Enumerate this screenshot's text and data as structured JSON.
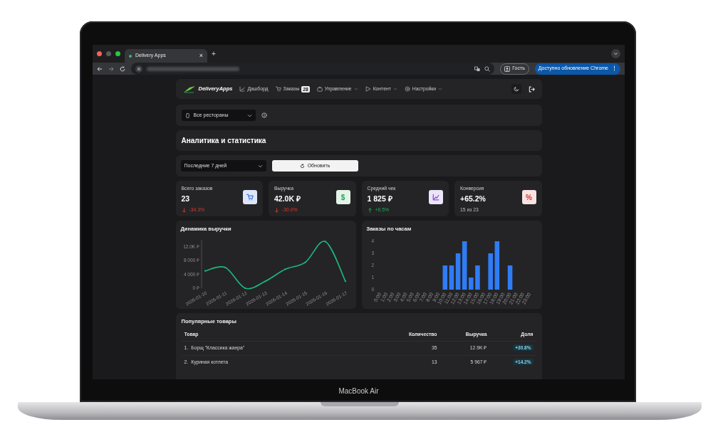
{
  "browser": {
    "tab": {
      "title": "Delivery Apps",
      "close": "×",
      "selected": true
    },
    "new_tab": "+",
    "profile": "Гость",
    "update_button": "Доступно обновление Chrome",
    "menu": "⋮"
  },
  "navbar": {
    "brand": "DeliveryApps",
    "items": [
      {
        "label": "Дашборд",
        "dropdown": false
      },
      {
        "label": "Заказы",
        "badge": "28",
        "dropdown": false
      },
      {
        "label": "Управление",
        "dropdown": true
      },
      {
        "label": "Контент",
        "dropdown": true
      },
      {
        "label": "Настройки",
        "dropdown": true
      }
    ]
  },
  "restaurant_select": {
    "value": "Все рестораны"
  },
  "page_title": "Аналитика и статистика",
  "period_select": {
    "value": "Последние 7 дней"
  },
  "refresh_button": "Обновить",
  "stats": [
    {
      "label": "Всего заказов",
      "value": "23",
      "change": "-34.3%",
      "kind": "down"
    },
    {
      "label": "Выручка",
      "value": "42.0K ₽",
      "change": "-30.0%",
      "kind": "down",
      "symbol": "$"
    },
    {
      "label": "Средний чек",
      "value": "1 825 ₽",
      "change": "+6.5%",
      "kind": "up"
    },
    {
      "label": "Конверсия",
      "value": "+65.2%",
      "change": "15 из 23",
      "kind": "plain",
      "symbol": "%"
    }
  ],
  "revenue_chart": {
    "title": "Динамика выручки",
    "chart_data": {
      "type": "line",
      "categories": [
        "2026-01-10",
        "2026-01-11",
        "2026-01-12",
        "2026-01-13",
        "2026-01-14",
        "2026-01-15",
        "2026-01-16",
        "2026-01-17"
      ],
      "series": [
        {
          "color": "#1db87c",
          "values": [
            5000,
            6000,
            0,
            2000,
            5500,
            7500,
            13500,
            2000
          ]
        }
      ],
      "ylim": [
        0,
        14000
      ],
      "yticks": [
        {
          "value": 0,
          "label": "0 ₽"
        },
        {
          "value": 4000,
          "label": "4 000 ₽"
        },
        {
          "value": 8000,
          "label": "8 000 ₽"
        },
        {
          "value": 12000,
          "label": "12.0K ₽"
        }
      ]
    }
  },
  "hourly_chart": {
    "title": "Заказы по часам",
    "chart_data": {
      "type": "bar",
      "categories": [
        "0:00",
        "1:00",
        "2:00",
        "3:00",
        "4:00",
        "5:00",
        "6:00",
        "7:00",
        "8:00",
        "9:00",
        "10:00",
        "11:00",
        "12:00",
        "13:00",
        "14:00",
        "15:00",
        "16:00",
        "17:00",
        "18:00",
        "19:00",
        "20:00",
        "21:00",
        "22:00",
        "23:00"
      ],
      "series": [
        {
          "color": "#2f7cf6",
          "values": [
            0,
            0,
            0,
            0,
            0,
            0,
            0,
            0,
            0,
            0,
            2,
            2,
            3,
            4,
            1,
            2,
            0,
            3,
            4,
            0,
            2,
            0,
            0,
            0
          ]
        }
      ],
      "ylim": [
        0,
        4
      ],
      "yticks": [
        0,
        1,
        2,
        3,
        4
      ]
    }
  },
  "popular_products": {
    "title": "Популярные товары",
    "columns": [
      "Товар",
      "Количество",
      "Выручка",
      "Доля"
    ],
    "rows": [
      {
        "rank": "1.",
        "name": "Борщ \"Классика жанра\"",
        "quantity": "35",
        "revenue": "12.9K ₽",
        "share": "+30.8%"
      },
      {
        "rank": "2.",
        "name": "Куриная котлета",
        "quantity": "13",
        "revenue": "5 967 ₽",
        "share": "+14.2%"
      }
    ]
  },
  "device_label": "MacBook Air"
}
